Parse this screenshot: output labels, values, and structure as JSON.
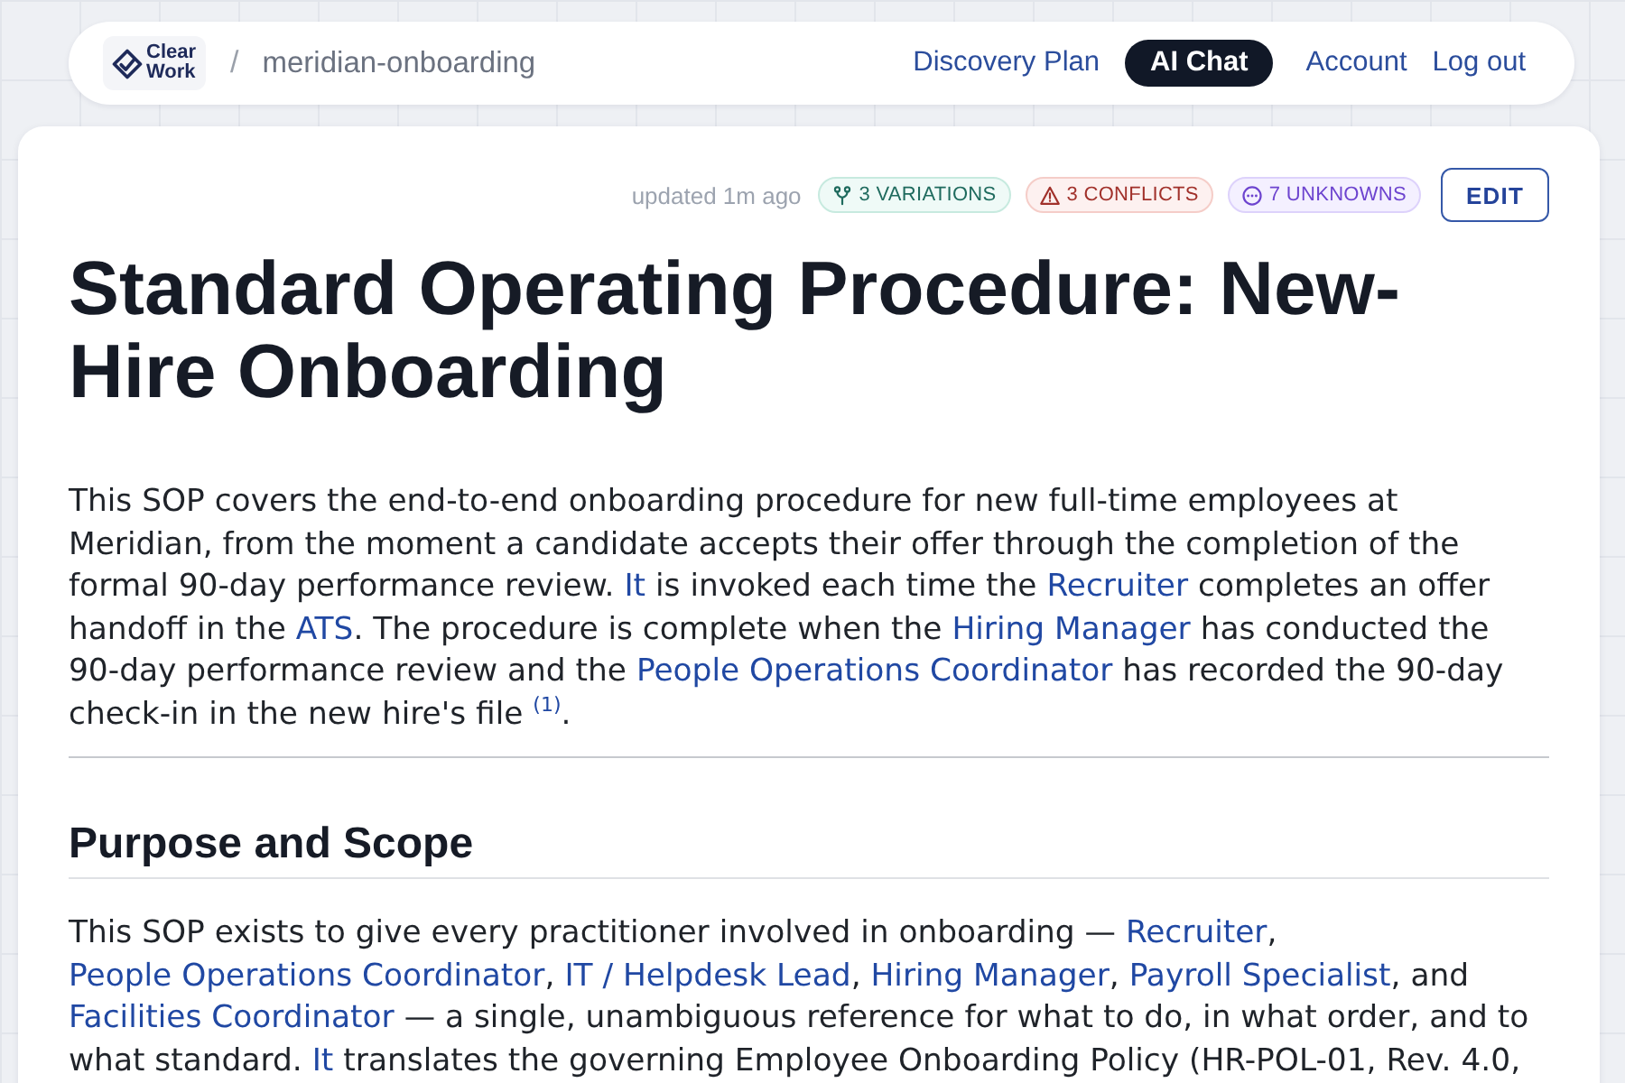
{
  "nav": {
    "logo_lines": [
      "Clear",
      "Work"
    ],
    "separator": "/",
    "project": "meridian-onboarding",
    "tabs": [
      {
        "label": "Discovery Plan",
        "selected": false
      },
      {
        "label": "AI Chat",
        "selected": true
      }
    ],
    "links": [
      "Account",
      "Log out"
    ]
  },
  "document": {
    "updated": "updated 1m ago",
    "badges": [
      {
        "kind": "variations",
        "label": "3 VARIATIONS"
      },
      {
        "kind": "conflicts",
        "label": "3 CONFLICTS"
      },
      {
        "kind": "unknowns",
        "label": "7 UNKNOWNS"
      }
    ],
    "edit_button": "EDIT",
    "title": "Standard Operating Procedure: New-Hire Onboarding",
    "intro": [
      {
        "kind": "text",
        "text": "This SOP covers the end-to-end onboarding procedure for new full-time employees at Meridian, from the moment a candidate accepts their offer through the completion of the formal 90-day performance review. "
      },
      {
        "kind": "link",
        "text": "It"
      },
      {
        "kind": "text",
        "text": " is invoked each time the "
      },
      {
        "kind": "link",
        "text": "Recruiter"
      },
      {
        "kind": "text",
        "text": " completes an offer handoff in the "
      },
      {
        "kind": "link",
        "text": "ATS"
      },
      {
        "kind": "text",
        "text": ". The procedure is complete when the "
      },
      {
        "kind": "link",
        "text": "Hiring Manager"
      },
      {
        "kind": "text",
        "text": " has conducted the 90-day performance review and the "
      },
      {
        "kind": "link",
        "text": "People Operations Coordinator"
      },
      {
        "kind": "text",
        "text": " has recorded the 90-day check-in in the new hire's file "
      },
      {
        "kind": "footnote",
        "text": "(1)"
      },
      {
        "kind": "text",
        "text": "."
      }
    ],
    "sections": [
      {
        "heading": "Purpose and Scope",
        "paragraph": [
          {
            "kind": "text",
            "text": "This SOP exists to give every practitioner involved in onboarding — "
          },
          {
            "kind": "link",
            "text": "Recruiter"
          },
          {
            "kind": "text",
            "text": ", "
          },
          {
            "kind": "link",
            "text": "People Operations Coordinator"
          },
          {
            "kind": "text",
            "text": ", "
          },
          {
            "kind": "link",
            "text": "IT / Helpdesk Lead"
          },
          {
            "kind": "text",
            "text": ", "
          },
          {
            "kind": "link",
            "text": "Hiring Manager"
          },
          {
            "kind": "text",
            "text": ", "
          },
          {
            "kind": "link",
            "text": "Payroll Specialist"
          },
          {
            "kind": "text",
            "text": ", and "
          },
          {
            "kind": "link",
            "text": "Facilities Coordinator"
          },
          {
            "kind": "text",
            "text": " — a single, unambiguous reference for what to do, in what order, and to what standard. "
          },
          {
            "kind": "link",
            "text": "It"
          },
          {
            "kind": "text",
            "text": " translates the governing Employee Onboarding Policy (HR-POL-01, Rev. 4.0,"
          }
        ]
      }
    ]
  }
}
